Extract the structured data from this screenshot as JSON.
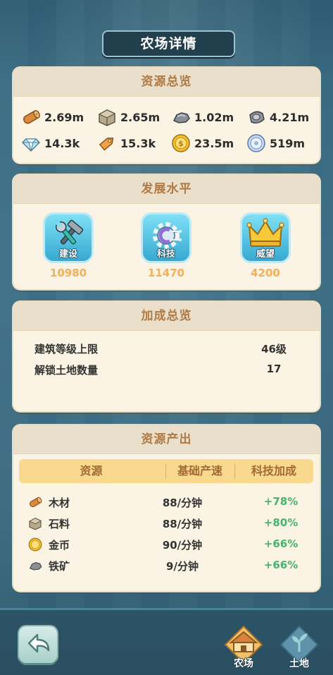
{
  "title": "农场详情",
  "resources_card": {
    "header": "资源总览",
    "items": [
      {
        "icon": "wood-icon",
        "value": "2.69m"
      },
      {
        "icon": "stone-icon",
        "value": "2.65m"
      },
      {
        "icon": "iron-ore-icon",
        "value": "1.02m"
      },
      {
        "icon": "steel-icon",
        "value": "4.21m"
      },
      {
        "icon": "crystal-icon",
        "value": "14.3k"
      },
      {
        "icon": "tag-icon",
        "value": "15.3k"
      },
      {
        "icon": "gold-coin-icon",
        "value": "23.5m"
      },
      {
        "icon": "silver-coin-icon",
        "value": "519m"
      }
    ]
  },
  "development_card": {
    "header": "发展水平",
    "items": [
      {
        "icon": "hammer-wrench-icon",
        "label": "建设",
        "value": "10980"
      },
      {
        "icon": "gear-tech-icon",
        "label": "科技",
        "value": "11470"
      },
      {
        "icon": "crown-icon",
        "label": "威望",
        "value": "4200"
      }
    ]
  },
  "bonus_card": {
    "header": "加成总览",
    "rows": [
      {
        "label": "建筑等级上限",
        "value": "46级"
      },
      {
        "label": "解锁土地数量",
        "value": "17"
      }
    ]
  },
  "production_card": {
    "header": "资源产出",
    "columns": [
      "资源",
      "基础产速",
      "科技加成"
    ],
    "rows": [
      {
        "icon": "wood-icon",
        "name": "木材",
        "rate": "88/分钟",
        "bonus": "+78%"
      },
      {
        "icon": "stone-icon",
        "name": "石料",
        "rate": "88/分钟",
        "bonus": "+80%"
      },
      {
        "icon": "gold-coin-icon",
        "name": "金币",
        "rate": "90/分钟",
        "bonus": "+66%"
      },
      {
        "icon": "iron-ore-icon",
        "name": "铁矿",
        "rate": "9/分钟",
        "bonus": "+66%"
      }
    ]
  },
  "bottom_nav": {
    "farm_label": "农场",
    "land_label": "土地"
  },
  "colors": {
    "card_bg": "#fbf4e4",
    "header_text": "#b07a45",
    "dev_value": "#f2b05a",
    "bonus_green": "#45b56e",
    "table_head_bg": "#f8d98e"
  }
}
